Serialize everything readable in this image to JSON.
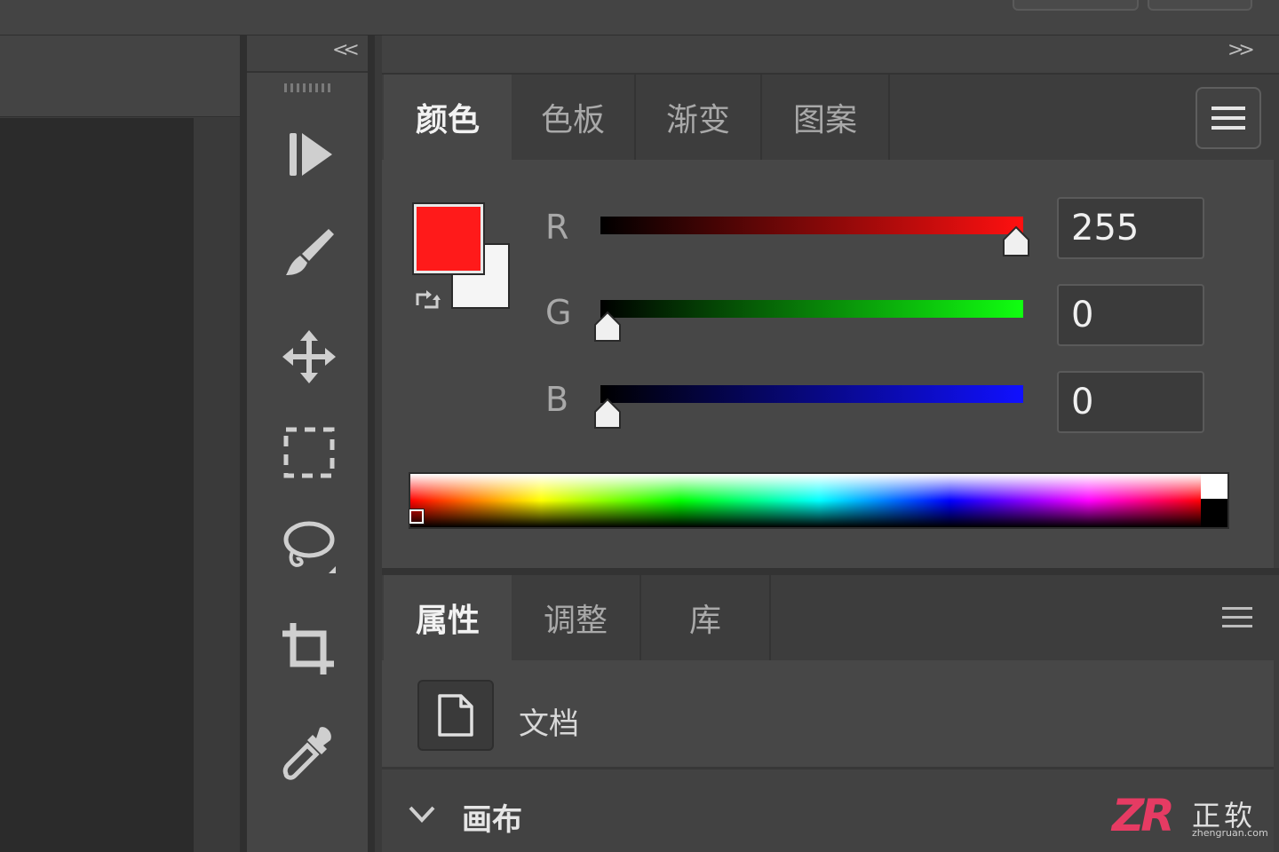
{
  "color_panel": {
    "tabs": [
      {
        "label": "颜色",
        "active": true
      },
      {
        "label": "色板",
        "active": false
      },
      {
        "label": "渐变",
        "active": false
      },
      {
        "label": "图案",
        "active": false
      }
    ],
    "foreground_color": "#ff1a1a",
    "background_color": "#f5f5f5",
    "channels": [
      {
        "label": "R",
        "value": "255",
        "fraction": 1.0,
        "gradient_end": "#ff1010"
      },
      {
        "label": "G",
        "value": "0",
        "fraction": 0.0,
        "gradient_end": "#10ff10"
      },
      {
        "label": "B",
        "value": "0",
        "fraction": 0.0,
        "gradient_end": "#1010ff"
      }
    ]
  },
  "properties_panel": {
    "tabs": [
      {
        "label": "属性",
        "active": true
      },
      {
        "label": "调整",
        "active": false
      },
      {
        "label": "库",
        "active": false
      }
    ],
    "document_label": "文档",
    "section_label": "画布"
  },
  "toolbar": {
    "collapse_label": "<<",
    "expand_label": ">>",
    "tools": [
      "play-icon",
      "brush-icon",
      "move-icon",
      "marquee-icon",
      "lasso-icon",
      "crop-icon",
      "eyedropper-icon"
    ]
  },
  "watermark": {
    "logo_text": "ZR",
    "brand_text": "正软",
    "site_text": "zhengruan.com"
  }
}
